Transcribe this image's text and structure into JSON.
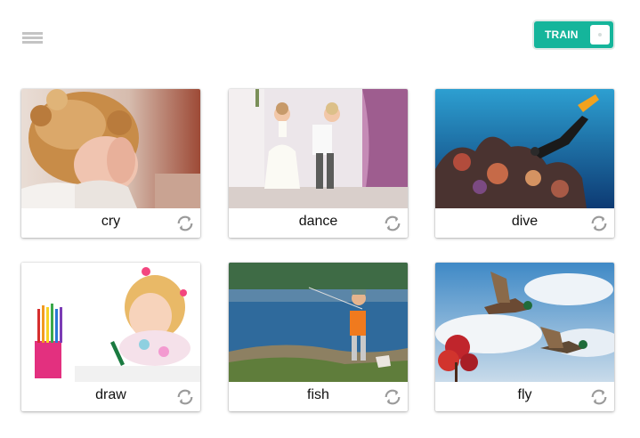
{
  "header": {
    "menu_icon": "hamburger-menu-icon",
    "mode_toggle": {
      "label": "TRAIN",
      "state": "on",
      "color": "#15b59b"
    }
  },
  "cards": [
    {
      "word": "cry",
      "image": "child-crying-photo",
      "action_icon": "refresh-icon"
    },
    {
      "word": "dance",
      "image": "children-dancing-photo",
      "action_icon": "refresh-icon"
    },
    {
      "word": "dive",
      "image": "scuba-diver-reef-photo",
      "action_icon": "refresh-icon"
    },
    {
      "word": "draw",
      "image": "girl-drawing-photo",
      "action_icon": "refresh-icon"
    },
    {
      "word": "fish",
      "image": "boy-fishing-photo",
      "action_icon": "refresh-icon"
    },
    {
      "word": "fly",
      "image": "ducks-flying-photo",
      "action_icon": "refresh-icon"
    }
  ]
}
